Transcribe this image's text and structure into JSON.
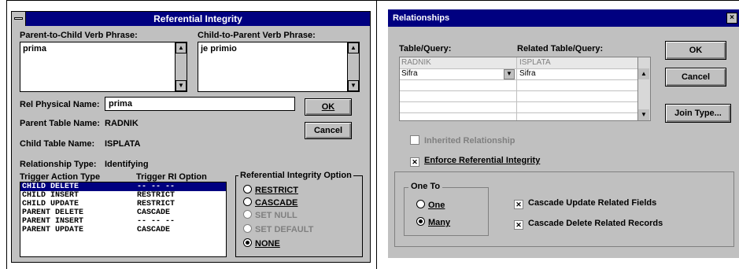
{
  "ri_dialog": {
    "title": "Referential Integrity",
    "parent_to_child_label": "Parent-to-Child Verb Phrase:",
    "parent_to_child_value": "prima",
    "child_to_parent_label": "Child-to-Parent Verb Phrase:",
    "child_to_parent_value": "je primio",
    "rel_physical_name_label": "Rel Physical Name:",
    "rel_physical_name_value": "prima",
    "ok_label": "OK",
    "cancel_label": "Cancel",
    "parent_table_label": "Parent Table Name:",
    "parent_table_value": "RADNIK",
    "child_table_label": "Child Table Name:",
    "child_table_value": "ISPLATA",
    "relationship_type_label": "Relationship Type:",
    "relationship_type_value": "Identifying",
    "trigger_action_header": "Trigger Action Type",
    "trigger_ri_header": "Trigger RI Option",
    "triggers": [
      {
        "action": "CHILD DELETE",
        "option": "-- -- --"
      },
      {
        "action": "CHILD INSERT",
        "option": "RESTRICT"
      },
      {
        "action": "CHILD UPDATE",
        "option": "RESTRICT"
      },
      {
        "action": "PARENT DELETE",
        "option": "CASCADE"
      },
      {
        "action": "PARENT INSERT",
        "option": "-- -- --"
      },
      {
        "action": "PARENT UPDATE",
        "option": "CASCADE"
      }
    ],
    "ri_option_group_label": "Referential Integrity Option",
    "ri_options": [
      {
        "label": "RESTRICT",
        "enabled": true,
        "selected": false
      },
      {
        "label": "CASCADE",
        "enabled": true,
        "selected": false
      },
      {
        "label": "SET NULL",
        "enabled": false,
        "selected": false
      },
      {
        "label": "SET DEFAULT",
        "enabled": false,
        "selected": false
      },
      {
        "label": "NONE",
        "enabled": true,
        "selected": true
      }
    ]
  },
  "rel_dialog": {
    "title": "Relationships",
    "table_query_label": "Table/Query:",
    "related_table_label": "Related Table/Query:",
    "grid_rows": [
      {
        "left": "RADNIK",
        "right": "ISPLATA"
      },
      {
        "left": "Sifra",
        "right": "Sifra"
      }
    ],
    "ok_label": "OK",
    "cancel_label": "Cancel",
    "join_type_label": "Join Type...",
    "inherited_label": "Inherited Relationship",
    "enforce_label": "Enforce Referential Integrity",
    "one_to_group_label": "One To",
    "one_label": "One",
    "many_label": "Many",
    "cascade_update_label": "Cascade Update Related Fields",
    "cascade_delete_label": "Cascade Delete Related Records"
  }
}
